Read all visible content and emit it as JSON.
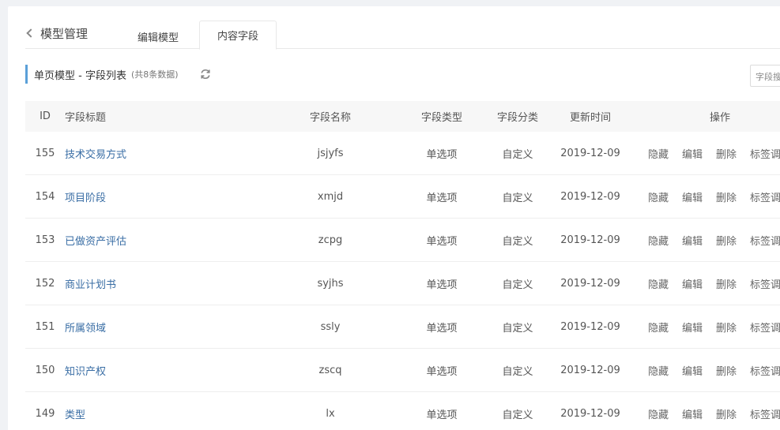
{
  "header": {
    "back_label": "模型管理",
    "tabs": [
      {
        "label": "编辑模型"
      },
      {
        "label": "内容字段"
      }
    ]
  },
  "section": {
    "title": "单页模型 - 字段列表",
    "count": "(共8条数据)"
  },
  "search": {
    "placeholder": "字段搜"
  },
  "table": {
    "columns": {
      "id": "ID",
      "title": "字段标题",
      "name": "字段名称",
      "type": "字段类型",
      "category": "字段分类",
      "updated": "更新时间",
      "ops": "操作"
    },
    "ops_labels": {
      "hide": "隐藏",
      "edit": "编辑",
      "delete": "删除",
      "tag": "标签调"
    },
    "rows": [
      {
        "id": "155",
        "title": "技术交易方式",
        "name": "jsjyfs",
        "type": "单选项",
        "category": "自定义",
        "updated": "2019-12-09"
      },
      {
        "id": "154",
        "title": "项目阶段",
        "name": "xmjd",
        "type": "单选项",
        "category": "自定义",
        "updated": "2019-12-09"
      },
      {
        "id": "153",
        "title": "已做资产评估",
        "name": "zcpg",
        "type": "单选项",
        "category": "自定义",
        "updated": "2019-12-09"
      },
      {
        "id": "152",
        "title": "商业计划书",
        "name": "syjhs",
        "type": "单选项",
        "category": "自定义",
        "updated": "2019-12-09"
      },
      {
        "id": "151",
        "title": "所属领域",
        "name": "ssly",
        "type": "单选项",
        "category": "自定义",
        "updated": "2019-12-09"
      },
      {
        "id": "150",
        "title": "知识产权",
        "name": "zscq",
        "type": "单选项",
        "category": "自定义",
        "updated": "2019-12-09"
      },
      {
        "id": "149",
        "title": "类型",
        "name": "lx",
        "type": "单选项",
        "category": "自定义",
        "updated": "2019-12-09"
      }
    ]
  },
  "colors": {
    "accent": "#5ba0d8",
    "link": "#3a6ea5",
    "header_bg": "#f7f7f7"
  }
}
